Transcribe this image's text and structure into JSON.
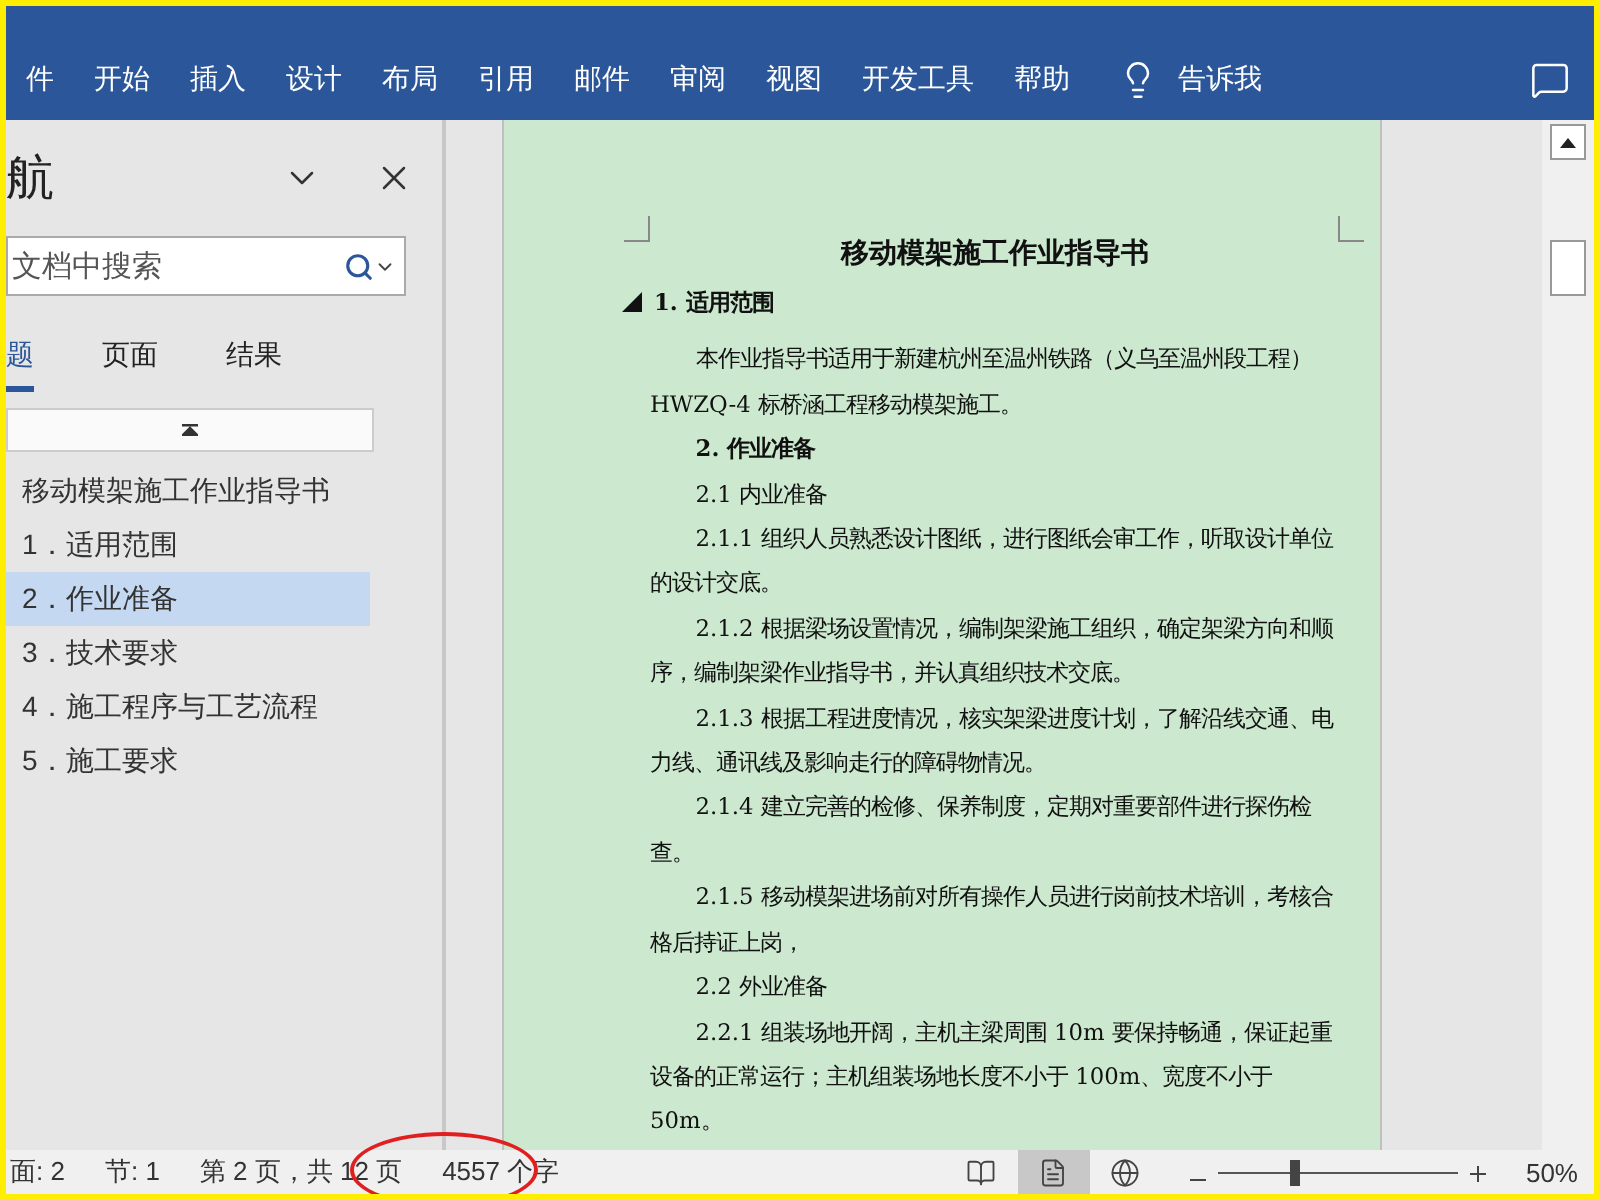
{
  "ribbon": {
    "tabs": [
      {
        "label": "件",
        "selected": false
      },
      {
        "label": "开始",
        "selected": false
      },
      {
        "label": "插入",
        "selected": false
      },
      {
        "label": "设计",
        "selected": false
      },
      {
        "label": "布局",
        "selected": false
      },
      {
        "label": "引用",
        "selected": false
      },
      {
        "label": "邮件",
        "selected": false
      },
      {
        "label": "审阅",
        "selected": false
      },
      {
        "label": "视图",
        "selected": false
      },
      {
        "label": "开发工具",
        "selected": false
      },
      {
        "label": "帮助",
        "selected": false
      }
    ],
    "tell_me": "告诉我"
  },
  "navigation": {
    "title": "航",
    "search": {
      "placeholder": "文档中搜索"
    },
    "tabs": [
      {
        "label": "题",
        "selected": true
      },
      {
        "label": "页面",
        "selected": false
      },
      {
        "label": "结果",
        "selected": false
      }
    ],
    "tree": [
      {
        "label": "移动模架施工作业指导书",
        "selected": false,
        "children": [
          {
            "label": "1．适用范围",
            "selected": false
          },
          {
            "label": "2．作业准备",
            "selected": true
          },
          {
            "label": "3．技术要求",
            "selected": false
          },
          {
            "label": "4．施工程序与工艺流程",
            "selected": false
          },
          {
            "label": "5．施工要求",
            "selected": false
          }
        ]
      }
    ]
  },
  "document": {
    "title": "移动模架施工作业指导书",
    "paragraphs": [
      {
        "kind": "heading",
        "text": "1. 适用范围"
      },
      {
        "kind": "body",
        "text": "本作业指导书适用于新建杭州至温州铁路（义乌至温州段工程）HWZQ-4 标桥涵工程移动模架施工。"
      },
      {
        "kind": "subheading",
        "text": "2. 作业准备"
      },
      {
        "kind": "body",
        "text": "2.1 内业准备"
      },
      {
        "kind": "body",
        "text": "2.1.1 组织人员熟悉设计图纸，进行图纸会审工作，听取设计单位的设计交底。"
      },
      {
        "kind": "body",
        "text": "2.1.2 根据梁场设置情况，编制架梁施工组织，确定架梁方向和顺序，编制架梁作业指导书，并认真组织技术交底。"
      },
      {
        "kind": "body",
        "text": "2.1.3 根据工程进度情况，核实架梁进度计划，了解沿线交通、电力线、通讯线及影响走行的障碍物情况。"
      },
      {
        "kind": "body",
        "text": "2.1.4 建立完善的检修、保养制度，定期对重要部件进行探伤检查。"
      },
      {
        "kind": "body",
        "text": "2.1.5 移动模架进场前对所有操作人员进行岗前技术培训，考核合格后持证上岗，"
      },
      {
        "kind": "body",
        "text": "2.2 外业准备"
      },
      {
        "kind": "body",
        "text": "2.2.1 组装场地开阔，主机主梁周围 10m 要保持畅通，保证起重设备的正常运行；主机组装场地长度不小于 100m、宽度不小于 50m。"
      }
    ]
  },
  "status_bar": {
    "items": [
      "面: 2",
      "节: 1",
      "第 2 页，共 12 页",
      "4557 个字"
    ],
    "views": [
      {
        "kind": "read",
        "selected": false
      },
      {
        "kind": "print",
        "selected": true
      },
      {
        "kind": "web",
        "selected": false
      }
    ],
    "zoom": {
      "level": 0.3,
      "reading": "50%"
    }
  }
}
